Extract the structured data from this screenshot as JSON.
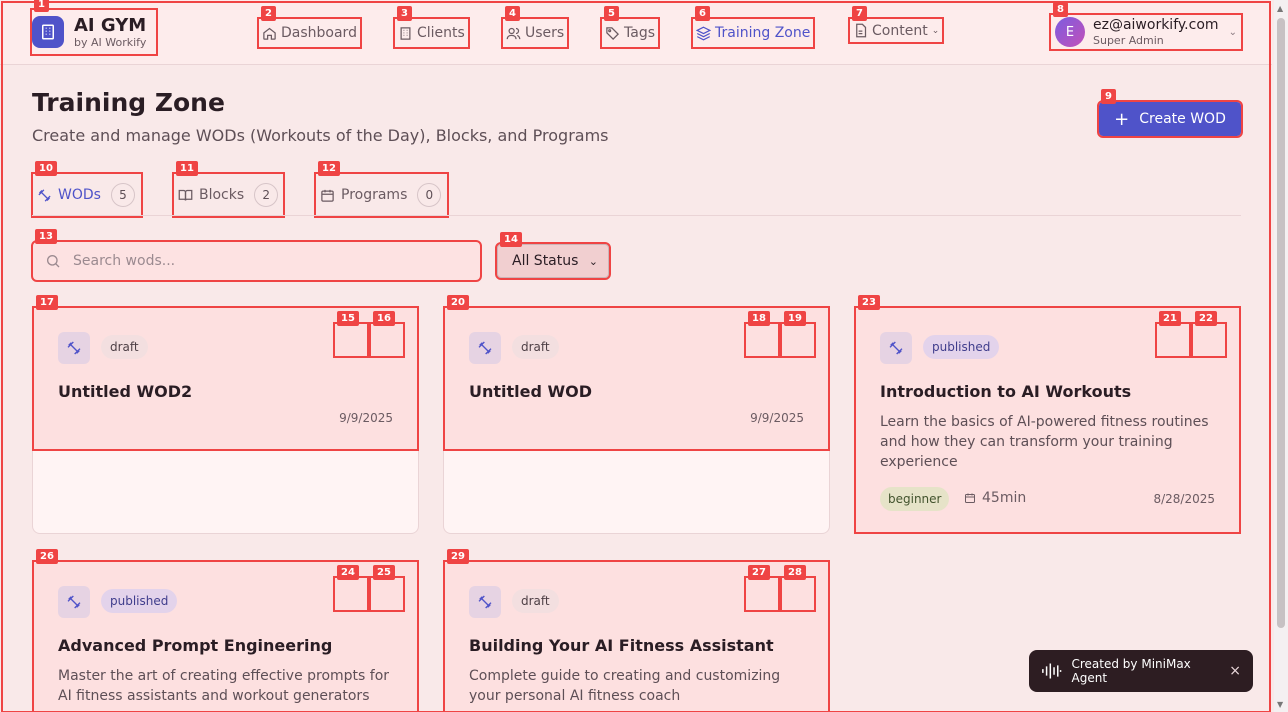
{
  "brand": {
    "title": "AI GYM",
    "subtitle": "by AI Workify"
  },
  "nav": [
    {
      "label": "Dashboard"
    },
    {
      "label": "Clients"
    },
    {
      "label": "Users"
    },
    {
      "label": "Tags"
    },
    {
      "label": "Training Zone"
    },
    {
      "label": "Content"
    }
  ],
  "user": {
    "initial": "E",
    "email": "ez@aiworkify.com",
    "role": "Super Admin"
  },
  "page": {
    "title": "Training Zone",
    "subtitle": "Create and manage WODs (Workouts of the Day), Blocks, and Programs",
    "create_label": "Create WOD"
  },
  "tabs": [
    {
      "label": "WODs",
      "count": "5"
    },
    {
      "label": "Blocks",
      "count": "2"
    },
    {
      "label": "Programs",
      "count": "0"
    }
  ],
  "search": {
    "placeholder": "Search wods..."
  },
  "status_filter": {
    "selected": "All Status"
  },
  "cards": [
    {
      "status": "draft",
      "title": "Untitled WOD2",
      "date": "9/9/2025"
    },
    {
      "status": "draft",
      "title": "Untitled WOD",
      "date": "9/9/2025"
    },
    {
      "status": "published",
      "title": "Introduction to AI Workouts",
      "description": "Learn the basics of AI-powered fitness routines and how they can transform your training experience",
      "level": "beginner",
      "duration": "45min",
      "date": "8/28/2025"
    },
    {
      "status": "published",
      "title": "Advanced Prompt Engineering",
      "description": "Master the art of creating effective prompts for AI fitness assistants and workout generators"
    },
    {
      "status": "draft",
      "title": "Building Your AI Fitness Assistant",
      "description": "Complete guide to creating and customizing your personal AI fitness coach"
    }
  ],
  "toast": {
    "label": "Created by MiniMax Agent",
    "close": "×"
  },
  "annotations": [
    "1",
    "2",
    "3",
    "4",
    "5",
    "6",
    "7",
    "8",
    "9",
    "10",
    "11",
    "12",
    "13",
    "14",
    "15",
    "16",
    "17",
    "18",
    "19",
    "20",
    "21",
    "22",
    "23",
    "24",
    "25",
    "26",
    "27",
    "28",
    "29"
  ],
  "colors": {
    "accent": "#4f53c9",
    "annotation": "#ef4444",
    "background": "#f9e9e9"
  }
}
